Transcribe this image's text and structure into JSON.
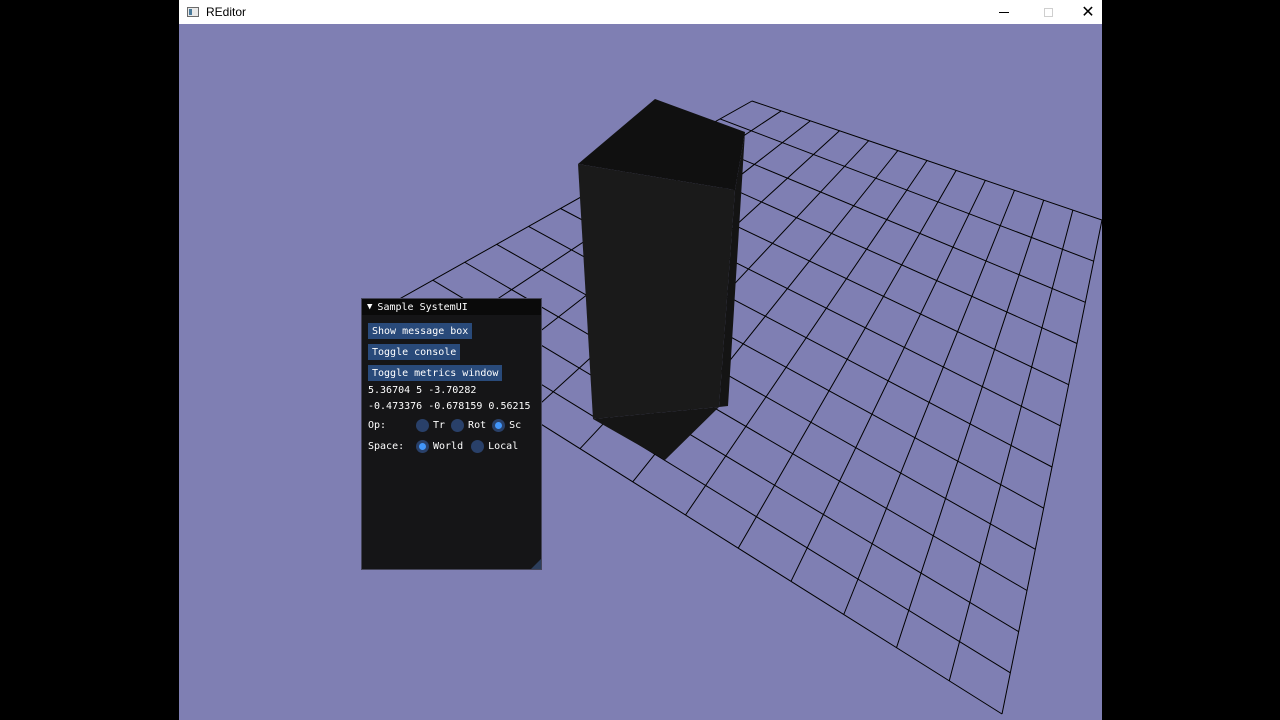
{
  "window": {
    "title": "REditor",
    "controls": {
      "minimize": "minimize",
      "maximize": "maximize",
      "close": "✕"
    }
  },
  "scene": {
    "background_color": "#7f7fb3",
    "grid_color": "#000000",
    "cube_color": "#151515"
  },
  "panel": {
    "title": "Sample SystemUI",
    "buttons": [
      "Show message box",
      "Toggle console",
      "Toggle metrics window"
    ],
    "position_text": "5.36704 5 -3.70282",
    "rotation_text": "-0.473376 -0.678159 0.56215",
    "op": {
      "label": "Op:",
      "options": [
        {
          "label": "Tr",
          "selected": false
        },
        {
          "label": "Rot",
          "selected": false
        },
        {
          "label": "Sc",
          "selected": true
        }
      ]
    },
    "space": {
      "label": "Space:",
      "options": [
        {
          "label": "World",
          "selected": true
        },
        {
          "label": "Local",
          "selected": false
        }
      ]
    }
  }
}
